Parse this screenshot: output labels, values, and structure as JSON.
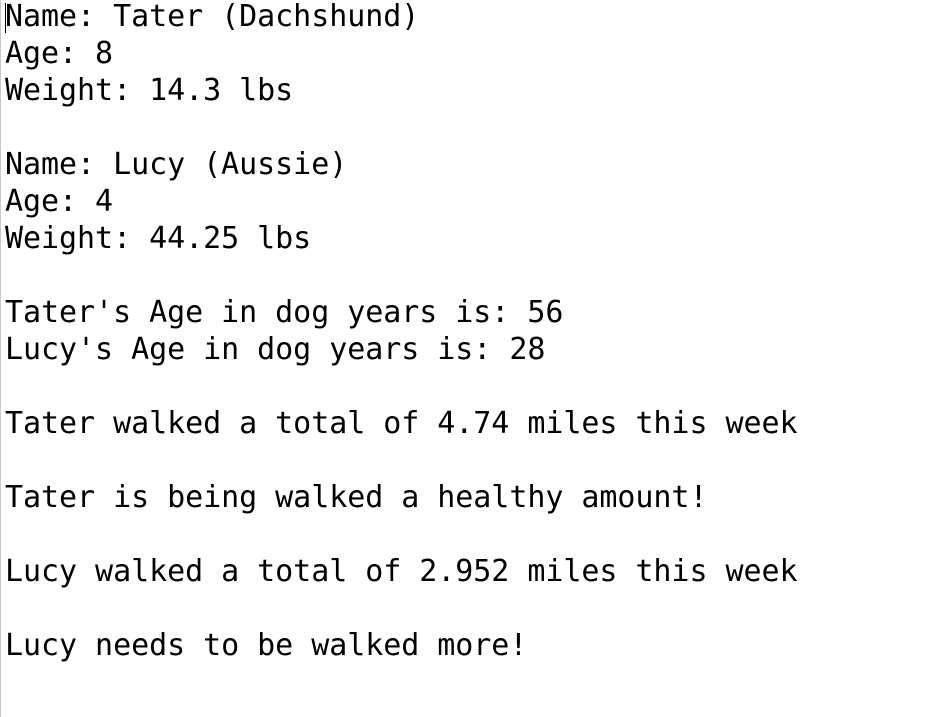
{
  "console": {
    "lines": [
      "Name: Tater (Dachshund)",
      "Age: 8",
      "Weight: 14.3 lbs",
      "",
      "Name: Lucy (Aussie)",
      "Age: 4",
      "Weight: 44.25 lbs",
      "",
      "Tater's Age in dog years is: 56",
      "Lucy's Age in dog years is: 28",
      "",
      "Tater walked a total of 4.74 miles this week",
      "",
      "Tater is being walked a healthy amount!",
      "",
      "Lucy walked a total of 2.952 miles this week",
      "",
      "Lucy needs to be walked more!"
    ]
  }
}
